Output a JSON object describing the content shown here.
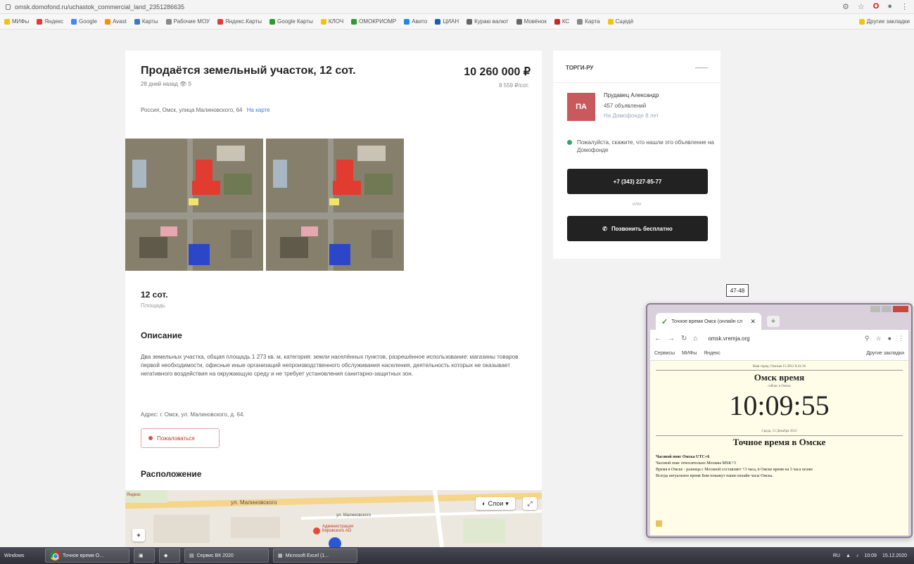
{
  "browser": {
    "url": "omsk.domofond.ru/uchastok_commercial_land_2351286635",
    "bookmarks": [
      "МИФы",
      "Яндекс",
      "Google",
      "Avast",
      "Карты",
      "Рабочие МОУ",
      "Яндекс.Карты",
      "Google Карты",
      "КЛОЧ",
      "ОМОКРИОМР",
      "Авито",
      "ЦИАН",
      "Кураю валют",
      "Мовёнок",
      "КС",
      "Карта",
      "Сщедё"
    ],
    "bookmark_colors": [
      "#f4c20d",
      "#e53935",
      "#4285f4",
      "#ff8f00",
      "#3b78c3",
      "#888888",
      "#e53935",
      "#2e9b2e",
      "#f4c20d",
      "#2e9b2e",
      "#1e88e5",
      "#1a5fb4",
      "#666666",
      "#666666",
      "#c62828",
      "#888888",
      "#f4c20d"
    ],
    "other_bookmarks": "Другие закладки"
  },
  "listing": {
    "title": "Продаётся земельный участок, 12 сот.",
    "price": "10 260 000 ₽",
    "price_per_unit": "8 559 ₽/сот.",
    "posted": "28 дней назад",
    "views": "5",
    "address": "Россия, Омск, улица Малиновского, 64",
    "map_link": "На карте",
    "area_value": "12 сот.",
    "area_label": "Площадь",
    "description_heading": "Описание",
    "description": "Два земельных участка, общая площадь 1 273 кв. м, категория: земли населённых пунктов, разрешённое использование: магазины товаров первой необходимости, офисные иные организаций непроизводственного обслуживания населения, деятельность которых не оказывает негативного воздействия на окружающую среду и не требует установления санитарно-защитных зон.",
    "description_address": "Адрес: г. Омск, ул. Малиновского, д. 64.",
    "complain_label": "Пожаловаться",
    "location_heading": "Расположение"
  },
  "map": {
    "street_name": "ул. Малиновского",
    "street_small": "ул. Малиновского",
    "poi_label": "Администрация Кировского АО",
    "layer_label": "Слои",
    "zoom_in": "+",
    "expand": "⤢",
    "provider": "Яндекс"
  },
  "seller": {
    "header": "ТОРГИ-РУ",
    "avatar_initials": "ПА",
    "name": "Прудавец Александр",
    "ads_count": "457 объявлений",
    "since": "На Домофонде 8 лет",
    "note": "Пожалуйста, скажите, что нашли это объявление на Домофонде",
    "phone_button": "+7 (343) 227-85-77",
    "or_label": "или",
    "free_call_button": "Позвонить бесплатно"
  },
  "overlay_label": "47-48",
  "popup": {
    "tab_title": "Точное время Омск (онлайн сл",
    "tab_close": "✕",
    "new_tab": "+",
    "url": "omsk.vremja.org",
    "bookmarks": [
      "Сервисы",
      "МИФы",
      "Яндекс"
    ],
    "other_bookmarks": "Другие закладки",
    "top_note": "Ваш город: Омская 15.2012 8:41:16",
    "city_title": "Омск время",
    "city_sub": "сейчас в Омске",
    "time": "10:09:55",
    "date_line": "Среда, 15 Декабря 2012",
    "exact_heading": "Точное время в Омске",
    "info_lines": [
      {
        "bold": "Часовой пояс Омска UTC+6",
        "text": ""
      },
      {
        "bold": "",
        "text": "Часовой пояс относительно Москвы MSK+3"
      },
      {
        "bold": "",
        "text": "Время в Омске - разница с Москвой составляет +3 часа, в Омске время на 3 часа позже"
      },
      {
        "bold": "",
        "text": "Всегда актуальное время Вам покажут наши онлайн часы Омска."
      }
    ]
  },
  "taskbar": {
    "start_label": "Windows",
    "items": [
      "Точное время О...",
      "Сервис ВК 2020",
      "Microsoft Excel (1..."
    ],
    "tray_time": "10:09",
    "tray_date": "15.12.2020",
    "tray_lang": "RU"
  }
}
